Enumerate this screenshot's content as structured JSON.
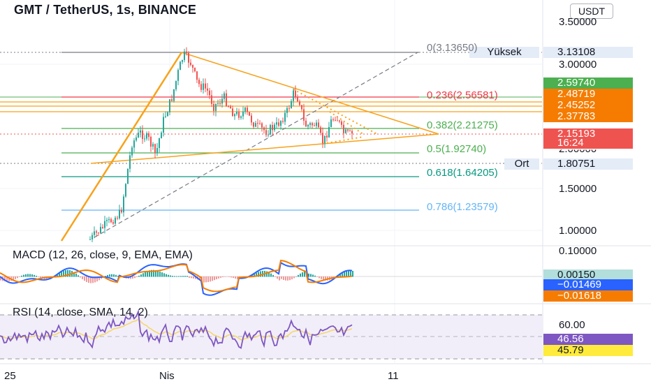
{
  "chart": {
    "symbol_title": "GMT / TetherUS, 1s, BINANCE",
    "currency": "USDT"
  },
  "price_axis": {
    "ticks": [
      {
        "label": "3.50000",
        "value": 3.5
      },
      {
        "label": "3.00000",
        "value": 3.0
      },
      {
        "label": "1.50000",
        "value": 1.5
      },
      {
        "label": "1.00000",
        "value": 1.0
      }
    ],
    "partial_label": "2.00000"
  },
  "price_tags": [
    {
      "label": "3.13108",
      "bg": "#e4ecf7",
      "fg": "#131722",
      "value": 3.13108
    },
    {
      "label": "2.59740",
      "bg": "#4caf50",
      "fg": "#ffffff",
      "value": 2.5974
    },
    {
      "label": "2.48719",
      "bg": "#f57c00",
      "fg": "#ffffff",
      "value": 2.48719
    },
    {
      "label": "2.45252",
      "bg": "#f57c00",
      "fg": "#ffffff",
      "value": 2.45252
    },
    {
      "label": "2.37783",
      "bg": "#f57c00",
      "fg": "#ffffff",
      "value": 2.37783
    },
    {
      "label": "2.15193",
      "bg": "#ef5350",
      "fg": "#ffffff",
      "value": 2.15193
    },
    {
      "label": "16:24",
      "bg": "#ef5350",
      "fg": "#ffffff"
    },
    {
      "label": "1.80751",
      "bg": "#e4ecf7",
      "fg": "#131722",
      "value": 1.80751
    }
  ],
  "side_tags": {
    "high_label": "Yüksek",
    "avg_label": "Ort"
  },
  "fib_levels": [
    {
      "label": "0(3.13650)",
      "level": 0,
      "price": 3.1365,
      "color": "#787b86"
    },
    {
      "label": "0.236(2.56581)",
      "level": 0.236,
      "price": 2.56581,
      "color": "#f23645"
    },
    {
      "label": "0.382(2.21275)",
      "level": 0.382,
      "price": 2.21275,
      "color": "#4caf50"
    },
    {
      "label": "0.5(1.92740)",
      "level": 0.5,
      "price": 1.9274,
      "color": "#4caf50"
    },
    {
      "label": "0.618(1.64205)",
      "level": 0.618,
      "price": 1.64205,
      "color": "#089981"
    },
    {
      "label": "0.786(1.23579)",
      "level": 0.786,
      "price": 1.23579,
      "color": "#64b5f6"
    }
  ],
  "macd": {
    "title": "MACD (12, 26, close, 9, EMA, EMA)",
    "axis_label": "0.10000",
    "tags": [
      {
        "label": "0.00150",
        "bg": "#b2dfdb",
        "fg": "#131722"
      },
      {
        "label": "−0.01469",
        "bg": "#2962ff",
        "fg": "#ffffff"
      },
      {
        "label": "−0.01618",
        "bg": "#f57c00",
        "fg": "#ffffff"
      }
    ]
  },
  "rsi": {
    "title": "RSI (14, close, SMA, 14, 2)",
    "axis_label": "60.00",
    "tags": [
      {
        "label": "46.56",
        "bg": "#7e57c2",
        "fg": "#ffffff"
      },
      {
        "label": "45.79",
        "bg": "#ffeb3b",
        "fg": "#131722"
      }
    ]
  },
  "time_axis": {
    "labels": [
      "25",
      "Nis",
      "11"
    ]
  },
  "colors": {
    "up": "#26a69a",
    "down": "#ef5350",
    "trendline": "#f7a21b",
    "macd_line": "#2962ff",
    "signal_line": "#f57c00",
    "rsi_line": "#7e57c2",
    "rsi_ma": "#f5d76e",
    "rsi_band": "#ede7f6"
  }
}
